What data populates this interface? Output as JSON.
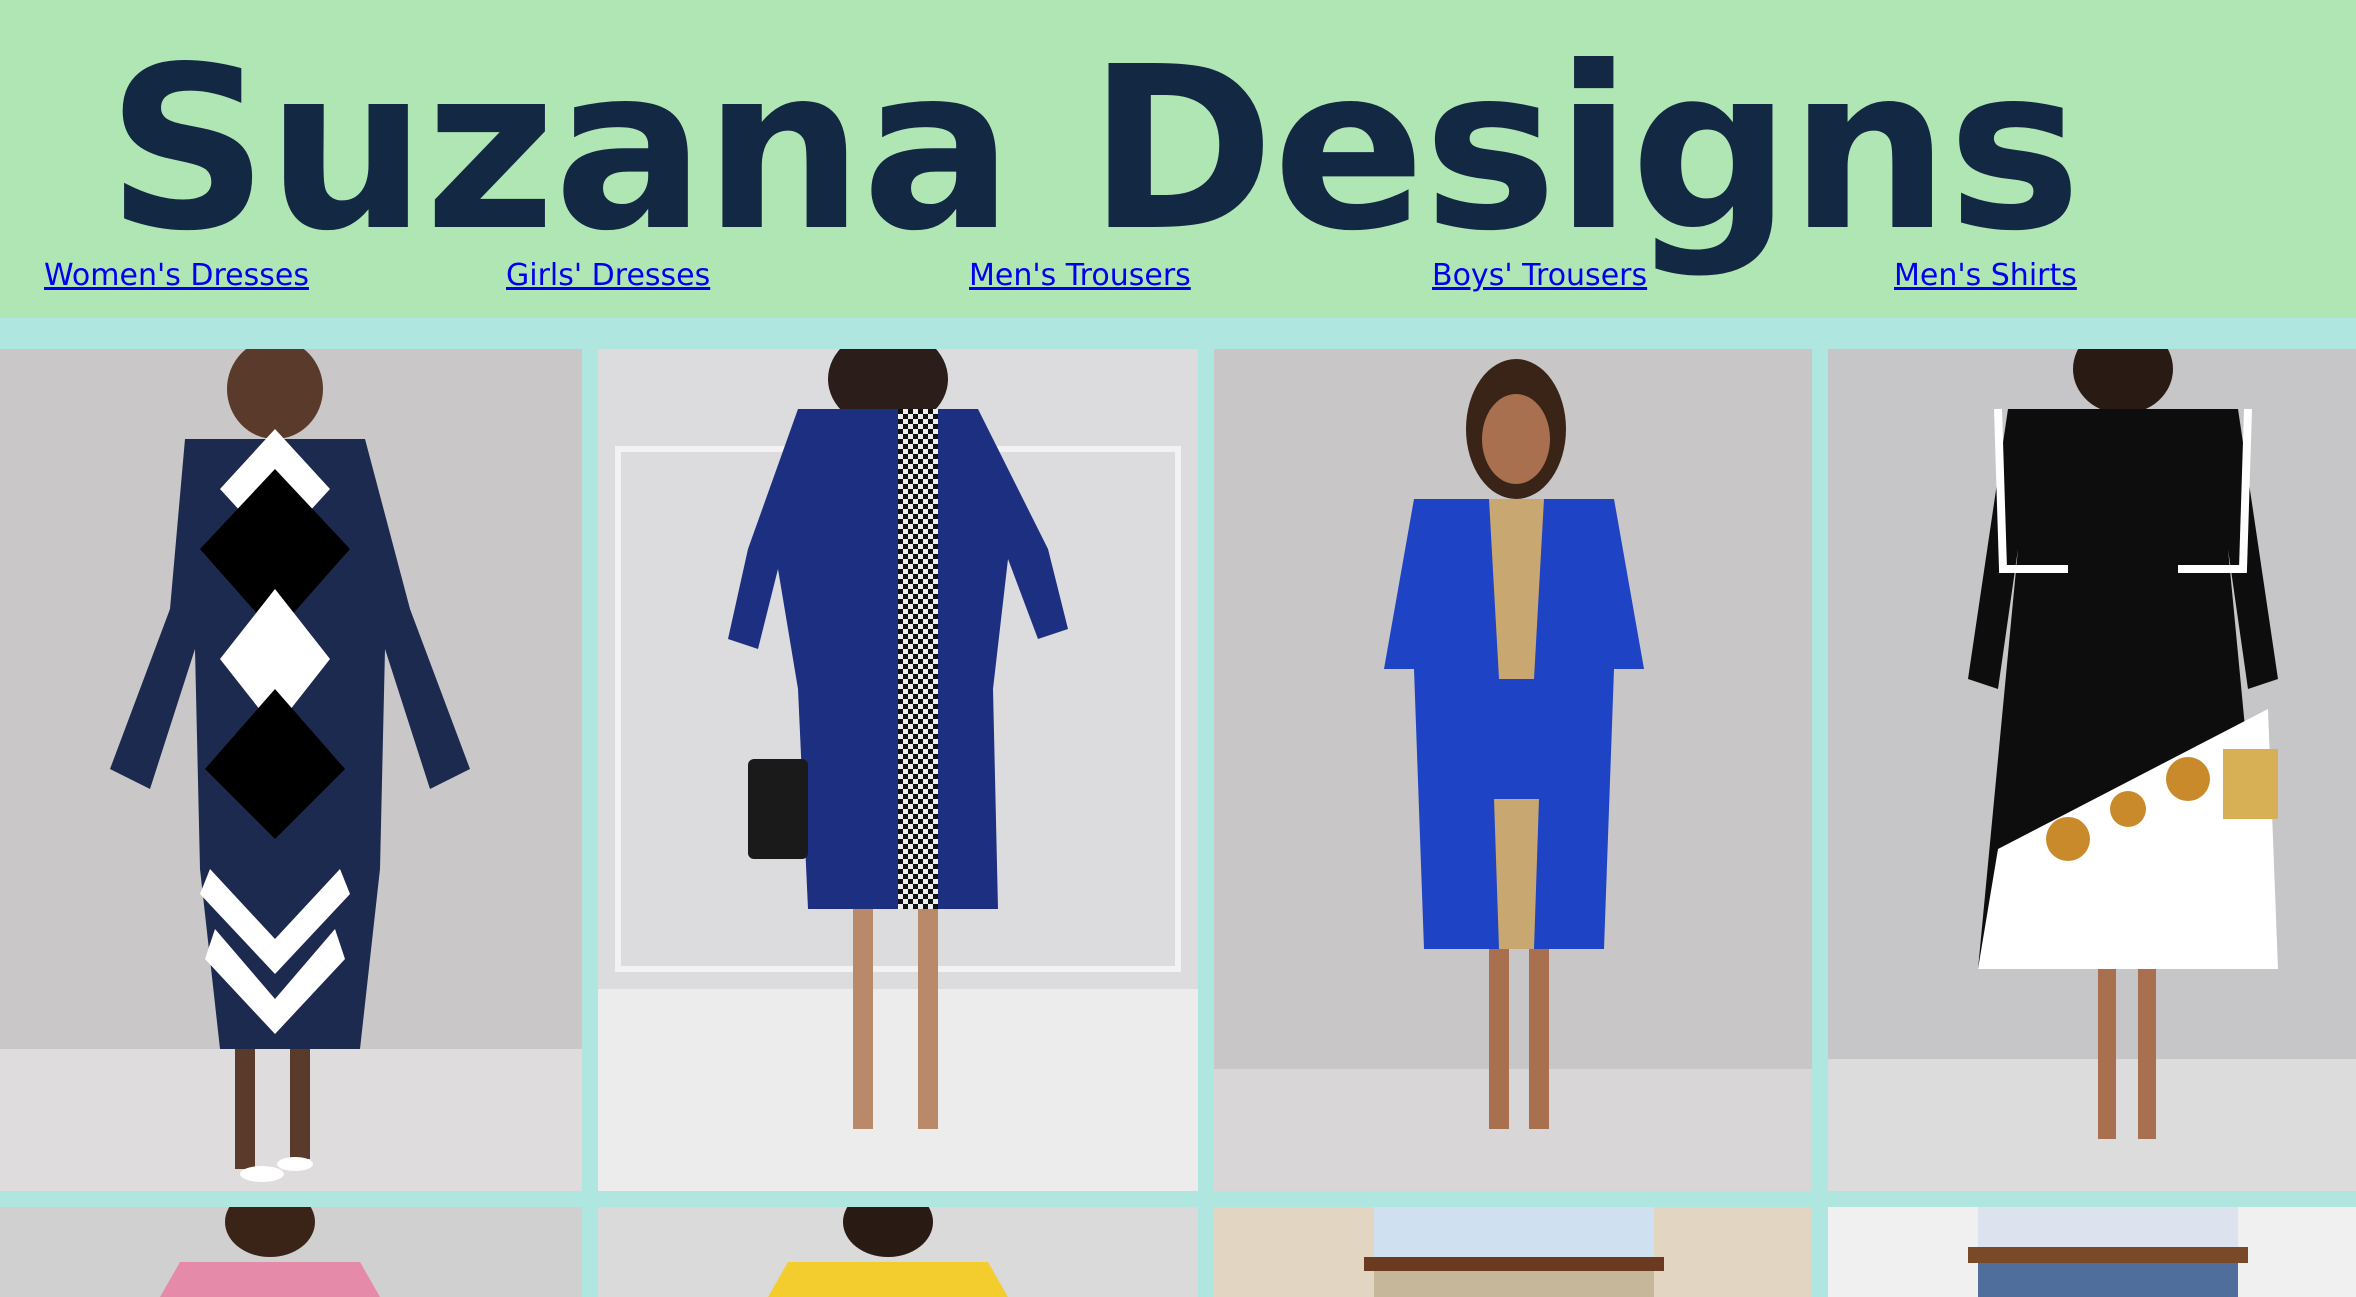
{
  "site": {
    "title": "Suzana Designs"
  },
  "nav": [
    {
      "label": "Women's Dresses"
    },
    {
      "label": "Girls' Dresses"
    },
    {
      "label": "Men's Trousers"
    },
    {
      "label": "Boys' Trousers"
    },
    {
      "label": "Men's Shirts"
    }
  ],
  "colors": {
    "header_bg": "#b0e6b4",
    "page_bg": "#b0e6e0",
    "title": "#132843",
    "link": "#0000ee"
  },
  "gallery": {
    "row1": [
      {
        "icon": "navy-geometric-dress-photo"
      },
      {
        "icon": "navy-houndstooth-dress-photo"
      },
      {
        "icon": "royal-blue-embroidered-dress-photo"
      },
      {
        "icon": "black-floral-jacket-dress-photo"
      }
    ],
    "row2": [
      {
        "icon": "pink-top-photo"
      },
      {
        "icon": "yellow-top-photo"
      },
      {
        "icon": "light-blue-shirt-trousers-photo"
      },
      {
        "icon": "plaid-shirt-jeans-photo"
      }
    ]
  }
}
